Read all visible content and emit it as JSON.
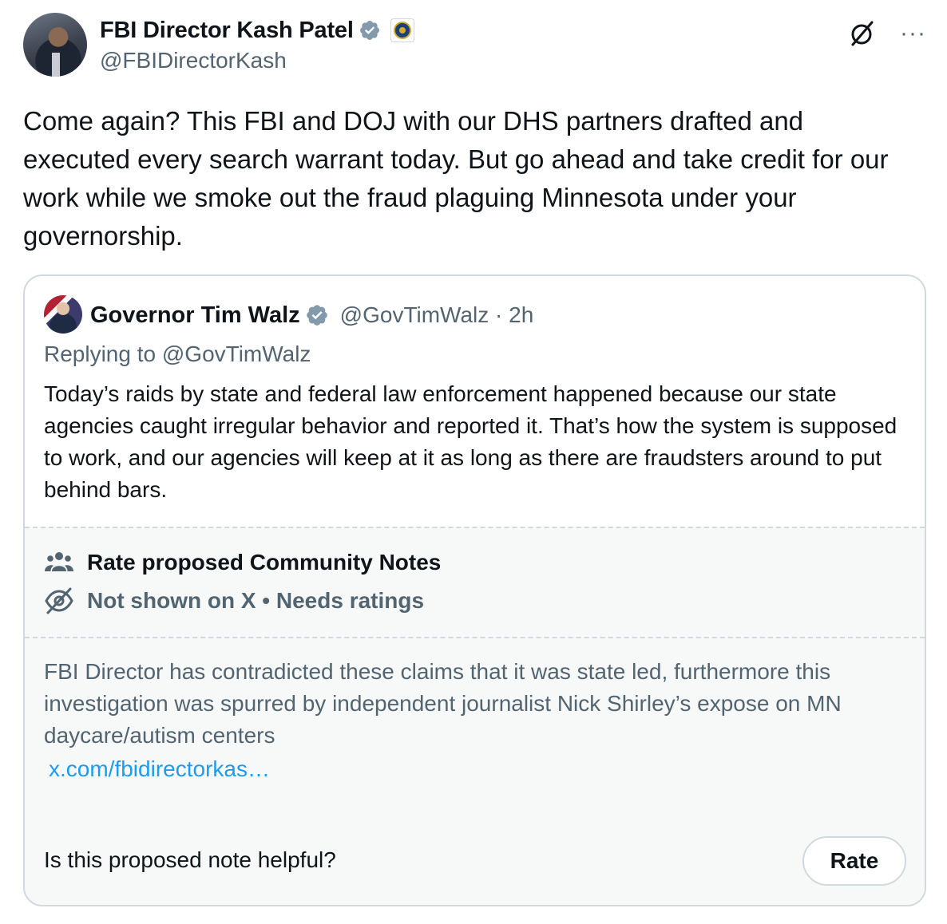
{
  "tweet": {
    "author": {
      "display_name": "FBI Director Kash Patel",
      "handle": "@FBIDirectorKash"
    },
    "text": "Come again? This FBI and DOJ with our DHS partners drafted and executed every search warrant today. But go ahead and take credit for our work while we smoke out the fraud plaguing Minnesota under your governorship."
  },
  "quoted": {
    "display_name": "Governor Tim Walz",
    "handle_time": "@GovTimWalz · 2h",
    "replying_to": "Replying to @GovTimWalz",
    "text": "Today’s raids by state and federal law enforcement happened because our state agencies caught irregular behavior and reported it. That’s how the system is supposed to work, and our agencies will keep at it as long as there are fraudsters around to put behind bars."
  },
  "community_note": {
    "title": "Rate proposed Community Notes",
    "status": "Not shown on X • Needs ratings",
    "note_text": "FBI Director has contradicted these claims that it was state led, furthermore this investigation was spurred by independent journalist Nick Shirley’s expose on MN daycare/autism centers",
    "link": "x.com/fbidirectorkas…",
    "question": "Is this proposed note helpful?",
    "rate_label": "Rate"
  },
  "icons": {
    "verified": "verified-badge-icon",
    "org": "fbi-seal-icon",
    "grok": "grok-icon",
    "more": "more-icon",
    "people": "people-icon",
    "hidden": "eye-slash-icon"
  },
  "colors": {
    "verified_blue": "#829aab",
    "link_blue": "#1d9bf0",
    "secondary_text": "#536471",
    "border": "#cfd9de",
    "note_bg": "#f7f9f9"
  }
}
